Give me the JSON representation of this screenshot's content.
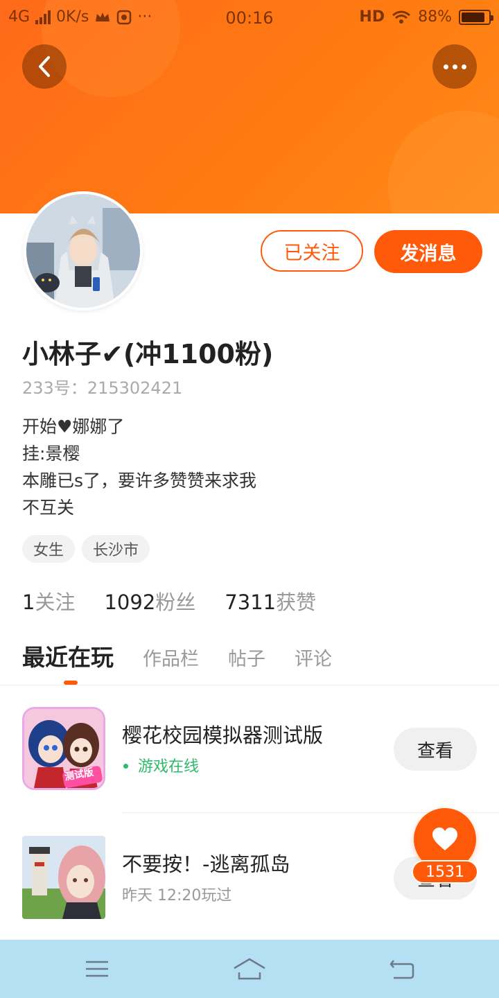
{
  "status_bar": {
    "network": "4G",
    "speed": "0K/s",
    "time": "00:16",
    "hd": "HD",
    "battery": "88%",
    "battery_level": 0.88
  },
  "profile": {
    "name": "小林子✔(冲1100粉)",
    "id_text": "233号：215302421",
    "bio": [
      "开始♥娜娜了",
      "挂:景樱",
      "本雕已s了，要许多赞赞来求我",
      "不互关"
    ],
    "tags": [
      "女生",
      "长沙市"
    ]
  },
  "actions": {
    "followed_label": "已关注",
    "message_label": "发消息"
  },
  "stats": [
    {
      "value": "1",
      "label": "关注"
    },
    {
      "value": "1092",
      "label": "粉丝"
    },
    {
      "value": "7311",
      "label": "获赞"
    }
  ],
  "tabs": [
    "最近在玩",
    "作品栏",
    "帖子",
    "评论"
  ],
  "games": [
    {
      "title": "樱花校园模拟器测试版",
      "status": "游戏在线",
      "button": "查看",
      "icon_badge": "测试版"
    },
    {
      "title": "不要按！-逃离孤岛",
      "status": "昨天 12:20玩过",
      "button": "查看"
    }
  ],
  "like": {
    "count": "1531"
  },
  "colors": {
    "accent": "#ff5a0a",
    "header": "#ff7a12",
    "online": "#2cbb68",
    "nav_bg": "#b5dff2"
  },
  "icons": [
    "back-arrow-icon",
    "more-dots-icon",
    "heart-icon",
    "menu-icon",
    "home-icon",
    "back-nav-icon"
  ]
}
